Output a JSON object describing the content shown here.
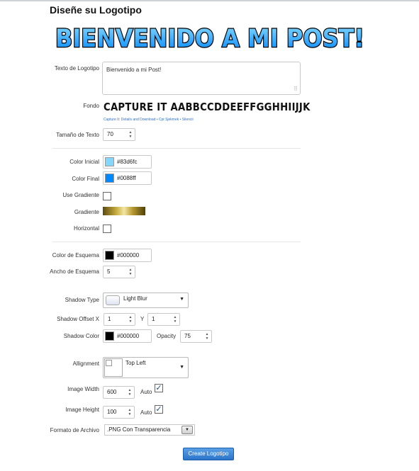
{
  "page": {
    "title": "Diseñe su Logotipo"
  },
  "banner": {
    "text": "BIENVENIDO A MI POST!"
  },
  "form": {
    "logo_text": {
      "label": "Texto de Logotipo",
      "value": "Bienvenido a mi Post!"
    },
    "font": {
      "label": "Fondo",
      "sample": "CAPTURE IT AABBCCDDEEFFGGHHIIJJK",
      "credit": "Capture It: Details and Download • Cpr.Sjekmek • Silencii"
    },
    "text_size": {
      "label": "Tamaño de Texto",
      "value": "70"
    },
    "start_color": {
      "label": "Color Inicial",
      "value": "#83d6fc",
      "swatch": "#83d6fc"
    },
    "end_color": {
      "label": "Color Final",
      "value": "#0088ff",
      "swatch": "#0088ff"
    },
    "use_gradient": {
      "label": "Use Gradiente",
      "checked": false
    },
    "gradient": {
      "label": "Gradiente"
    },
    "horizontal": {
      "label": "Horizontal",
      "checked": false
    },
    "outline_color": {
      "label": "Color de Esquema",
      "value": "#000000",
      "swatch": "#000000"
    },
    "outline_width": {
      "label": "Ancho de Esquema",
      "value": "5"
    },
    "shadow_type": {
      "label": "Shadow Type",
      "value": "Light Blur"
    },
    "shadow_offset": {
      "label": "Shadow Offset X",
      "x": "1",
      "y_label": "Y",
      "y": "1"
    },
    "shadow_color": {
      "label": "Shadow Color",
      "value": "#000000",
      "swatch": "#000000"
    },
    "opacity": {
      "label": "Opacity",
      "value": "75"
    },
    "alignment": {
      "label": "Allignment",
      "value": "Top Left"
    },
    "image_width": {
      "label": "Image Width",
      "value": "600",
      "auto_label": "Auto",
      "auto": true
    },
    "image_height": {
      "label": "Image Height",
      "value": "100",
      "auto_label": "Auto",
      "auto": true
    },
    "file_format": {
      "label": "Formato de Archivo",
      "value": ".PNG Con Transparencia"
    },
    "submit": {
      "label": "Create Logotipo"
    }
  },
  "icons": {
    "spin": "spinner-arrows-icon",
    "caret": "chevron-down-icon",
    "check": "checkmark-icon",
    "grip": "resize-grip-icon"
  }
}
